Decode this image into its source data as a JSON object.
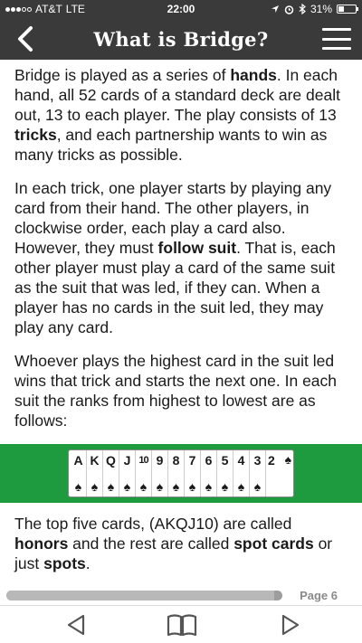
{
  "status": {
    "carrier": "AT&T",
    "network": "LTE",
    "time": "22:00",
    "battery": "31%",
    "battery_level": 0.31
  },
  "header": {
    "title": "What is Bridge?",
    "back_icon": "chevron-left-icon",
    "menu_icon": "hamburger-menu-icon"
  },
  "content": {
    "p1": [
      {
        "t": "Bridge is played as a series of "
      },
      {
        "t": "hands",
        "b": true
      },
      {
        "t": ". In each hand, all 52 cards of a standard deck are dealt out, 13 to each player. The play consists of 13 "
      },
      {
        "t": "tricks",
        "b": true
      },
      {
        "t": ", and each partnership wants to win as many tricks as possible."
      }
    ],
    "p2": [
      {
        "t": "In each trick, one player starts by playing any card from their hand. The other players, in clockwise order, each play a card also. However, they must "
      },
      {
        "t": "follow suit",
        "b": true
      },
      {
        "t": ". That is, each other player must play a card of the same suit as the suit that was led, if they can. When a player has no cards in the suit led, they may play any card."
      }
    ],
    "p3": [
      {
        "t": "Whoever plays the highest card in the suit led wins that trick and starts the next one. In each suit the ranks from highest to lowest are as follows:"
      }
    ],
    "cards": {
      "ranks": [
        "A",
        "K",
        "Q",
        "J",
        "10",
        "9",
        "8",
        "7",
        "6",
        "5",
        "4",
        "3",
        "2"
      ],
      "suit": "♠"
    },
    "p4": [
      {
        "t": "The top five cards, (AKQJ10) are called "
      },
      {
        "t": "honors",
        "b": true
      },
      {
        "t": " and the rest are called "
      },
      {
        "t": "spot cards",
        "b": true
      },
      {
        "t": " or just "
      },
      {
        "t": "spots",
        "b": true
      },
      {
        "t": "."
      }
    ]
  },
  "progress": {
    "page_label": "Page 6",
    "fraction": 0.97
  },
  "toolbar": {
    "prev_icon": "triangle-left-icon",
    "book_icon": "open-book-icon",
    "next_icon": "triangle-right-icon"
  }
}
